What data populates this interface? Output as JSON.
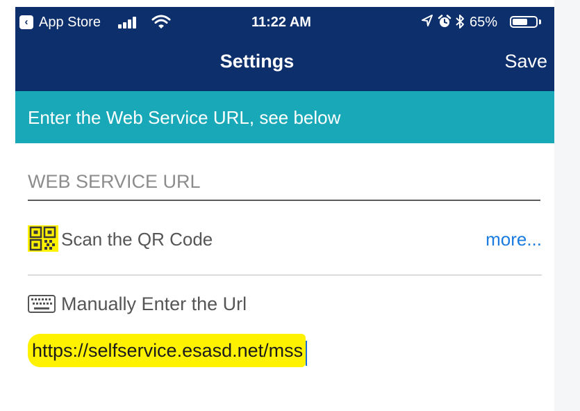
{
  "status_bar": {
    "back_app": "App Store",
    "time": "11:22 AM",
    "battery": "65%",
    "battery_level": 0.65
  },
  "nav": {
    "title": "Settings",
    "save_label": "Save"
  },
  "banner": {
    "text": "Enter the Web Service URL, see below"
  },
  "url_field": {
    "placeholder": "WEB SERVICE URL",
    "value": ""
  },
  "qr": {
    "label": "Scan the QR Code",
    "more_label": "more..."
  },
  "manual": {
    "label": "Manually Enter the Url",
    "typed_value": "https://selfservice.esasd.net/mss"
  },
  "colors": {
    "nav_bg": "#0d2f6c",
    "banner_bg": "#19a8b8",
    "link": "#1a7be0",
    "highlight": "#fff200"
  },
  "icons": {
    "back": "chevron-left-icon",
    "signal": "cell-signal-icon",
    "wifi": "wifi-icon",
    "location": "location-arrow-icon",
    "alarm": "alarm-clock-icon",
    "bluetooth": "bluetooth-icon",
    "battery": "battery-icon",
    "qr": "qr-code-icon",
    "keyboard": "keyboard-icon"
  }
}
